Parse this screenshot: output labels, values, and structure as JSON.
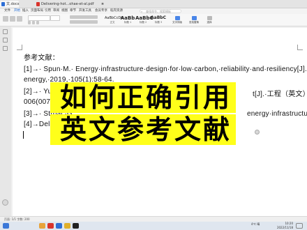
{
  "tabs": [
    {
      "label": "文.docx",
      "type": "doc",
      "active": true
    },
    {
      "label": "Delivering-hot...ohae-et-al.pdf",
      "type": "pdf",
      "active": false
    }
  ],
  "menus": [
    "文件",
    "开始",
    "插入",
    "页面布局",
    "引用",
    "审阅",
    "视图",
    "章节",
    "开发工具",
    "会员专享",
    "稻壳资源"
  ],
  "active_menu": "开始",
  "search": {
    "placeholder": "查找命令、搜索模板"
  },
  "ribbon": {
    "styles": [
      {
        "preview": "AaBbCcDd",
        "name": "正文"
      },
      {
        "preview": "AaBb",
        "name": "标题 1"
      },
      {
        "preview": "AaBbC",
        "name": "标题 2"
      },
      {
        "preview": "AaBbC",
        "name": "标题 3"
      }
    ],
    "tools": [
      "文字排版",
      "查找替换",
      "选择"
    ]
  },
  "document": {
    "heading": "参考文献：",
    "lines": [
      "[1]→· Spun·M.· Energy·infrastructure·design·for·low·carbon,·reliability·and·resiliency[J].·Dist",
      "energy,·2019,·105(1):58-64.",
      "[2]→· Yu·Y.·E",
      "006(007):P.7",
      "[3]→· Strbac·G",
      "[4]→Deliverin"
    ],
    "frag_2": "t[J].·工程（英文）,·2",
    "frag_3": "energy·infrastructu"
  },
  "overlay": {
    "line1": "如何正确引用",
    "line2": "英文参考文献"
  },
  "statusbar": {
    "left": "页面: 1/1   字数: 200"
  },
  "tray": {
    "weather": "4℃ 晴",
    "time": "10:20",
    "date": "2022/11/18"
  },
  "colors": {
    "overlay_bg": "#ffff1a",
    "accent": "#1f6bd6"
  }
}
